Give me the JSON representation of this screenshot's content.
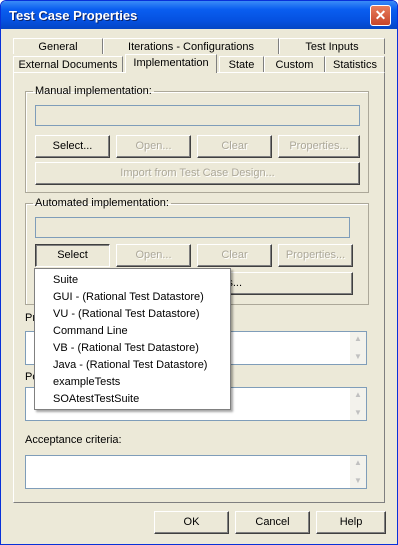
{
  "window": {
    "title": "Test Case Properties",
    "close_glyph": "✕"
  },
  "tabs_row1": [
    "General",
    "Iterations - Configurations",
    "Test Inputs"
  ],
  "tabs_row2": [
    "External Documents",
    "Implementation",
    "State",
    "Custom",
    "Statistics"
  ],
  "manual": {
    "legend": "Manual implementation:",
    "field_value": "",
    "buttons": {
      "select": "Select...",
      "open": "Open...",
      "clear": "Clear",
      "properties": "Properties..."
    },
    "import_button": "Import from Test Case Design..."
  },
  "automated": {
    "legend": "Automated implementation:",
    "field_value": "",
    "buttons": {
      "select": "Select",
      "open": "Open...",
      "clear": "Clear",
      "properties": "Properties..."
    },
    "partial_button_suffix": "s..."
  },
  "prerequisites_label_partial": "Pr",
  "postconditions_label_partial": "Po",
  "acceptance_label": "Acceptance criteria:",
  "dropdown_menu": [
    "Suite",
    "GUI - (Rational Test Datastore)",
    "VU - (Rational Test Datastore)",
    "Command Line",
    "VB - (Rational Test Datastore)",
    "Java - (Rational Test Datastore)",
    "exampleTests",
    "SOAtestTestSuite"
  ],
  "footer": {
    "ok": "OK",
    "cancel": "Cancel",
    "help": "Help"
  }
}
